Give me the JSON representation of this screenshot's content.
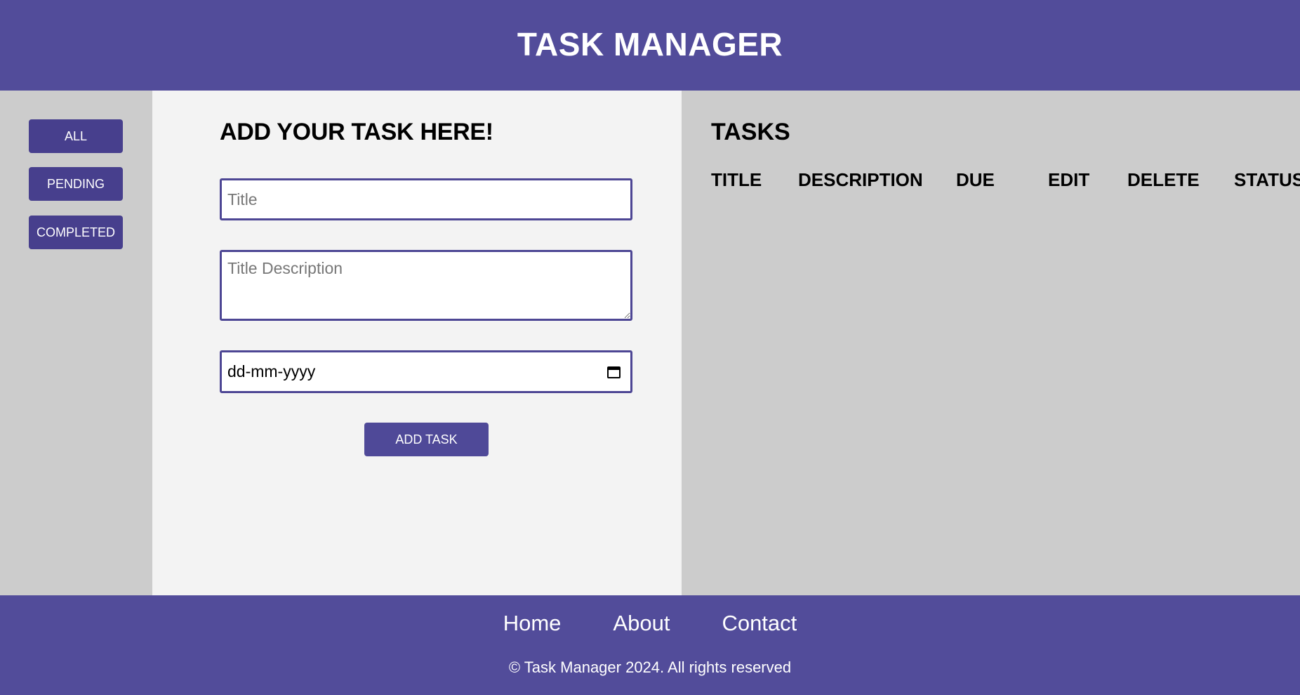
{
  "header": {
    "title": "TASK MANAGER"
  },
  "sidebar": {
    "filters": [
      {
        "label": "ALL"
      },
      {
        "label": "PENDING"
      },
      {
        "label": "COMPLETED"
      }
    ]
  },
  "form": {
    "heading": "ADD YOUR TASK HERE!",
    "title_placeholder": "Title",
    "title_value": "",
    "description_placeholder": "Title Description",
    "description_value": "",
    "date_placeholder": "dd-mm-yyyy",
    "date_icon": "calendar-icon",
    "submit_label": "ADD TASK"
  },
  "tasks": {
    "heading": "TASKS",
    "columns": [
      "TITLE",
      "DESCRIPTION",
      "DUE",
      "EDIT",
      "DELETE",
      "STATUS"
    ],
    "rows": []
  },
  "footer": {
    "links": [
      "Home",
      "About",
      "Contact"
    ],
    "copyright": "© Task Manager 2024. All rights reserved"
  },
  "colors": {
    "brand": "#524c9a",
    "button": "#473f8d",
    "sidebar_bg": "#cccccc",
    "form_bg": "#f3f3f3"
  }
}
